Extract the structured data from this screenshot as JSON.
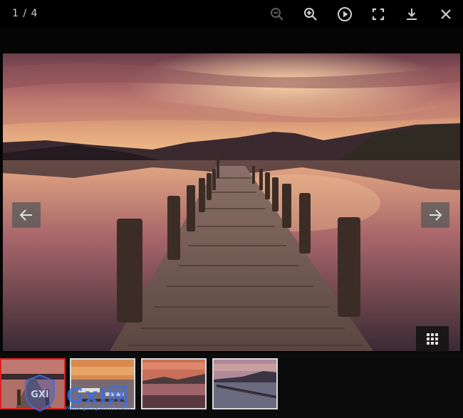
{
  "viewer": {
    "counter": "1 / 4",
    "toolbar": {
      "zoom_out_icon": "zoom-out-icon",
      "zoom_in_icon": "zoom-in-icon",
      "play_icon": "play-icon",
      "fullscreen_icon": "fullscreen-icon",
      "download_icon": "download-icon",
      "close_icon": "close-icon"
    },
    "nav": {
      "prev_icon": "arrow-left-icon",
      "next_icon": "arrow-right-icon"
    },
    "grid_icon": "grid-icon",
    "thumbnails": [
      {
        "subject": "pier at sunset",
        "active": true
      },
      {
        "subject": "boats at sunset",
        "active": false
      },
      {
        "subject": "lake at sunset",
        "active": false
      },
      {
        "subject": "long pier on lake",
        "active": false
      }
    ],
    "watermark": {
      "brand": "GxI网",
      "url": "www.gxlsystem.com",
      "color": "#3c6edc"
    },
    "colors": {
      "background": "#000000",
      "active_thumb_border": "#dd2222",
      "thumb_border": "#d8d8d8",
      "icon": "#d0d0d0"
    }
  }
}
